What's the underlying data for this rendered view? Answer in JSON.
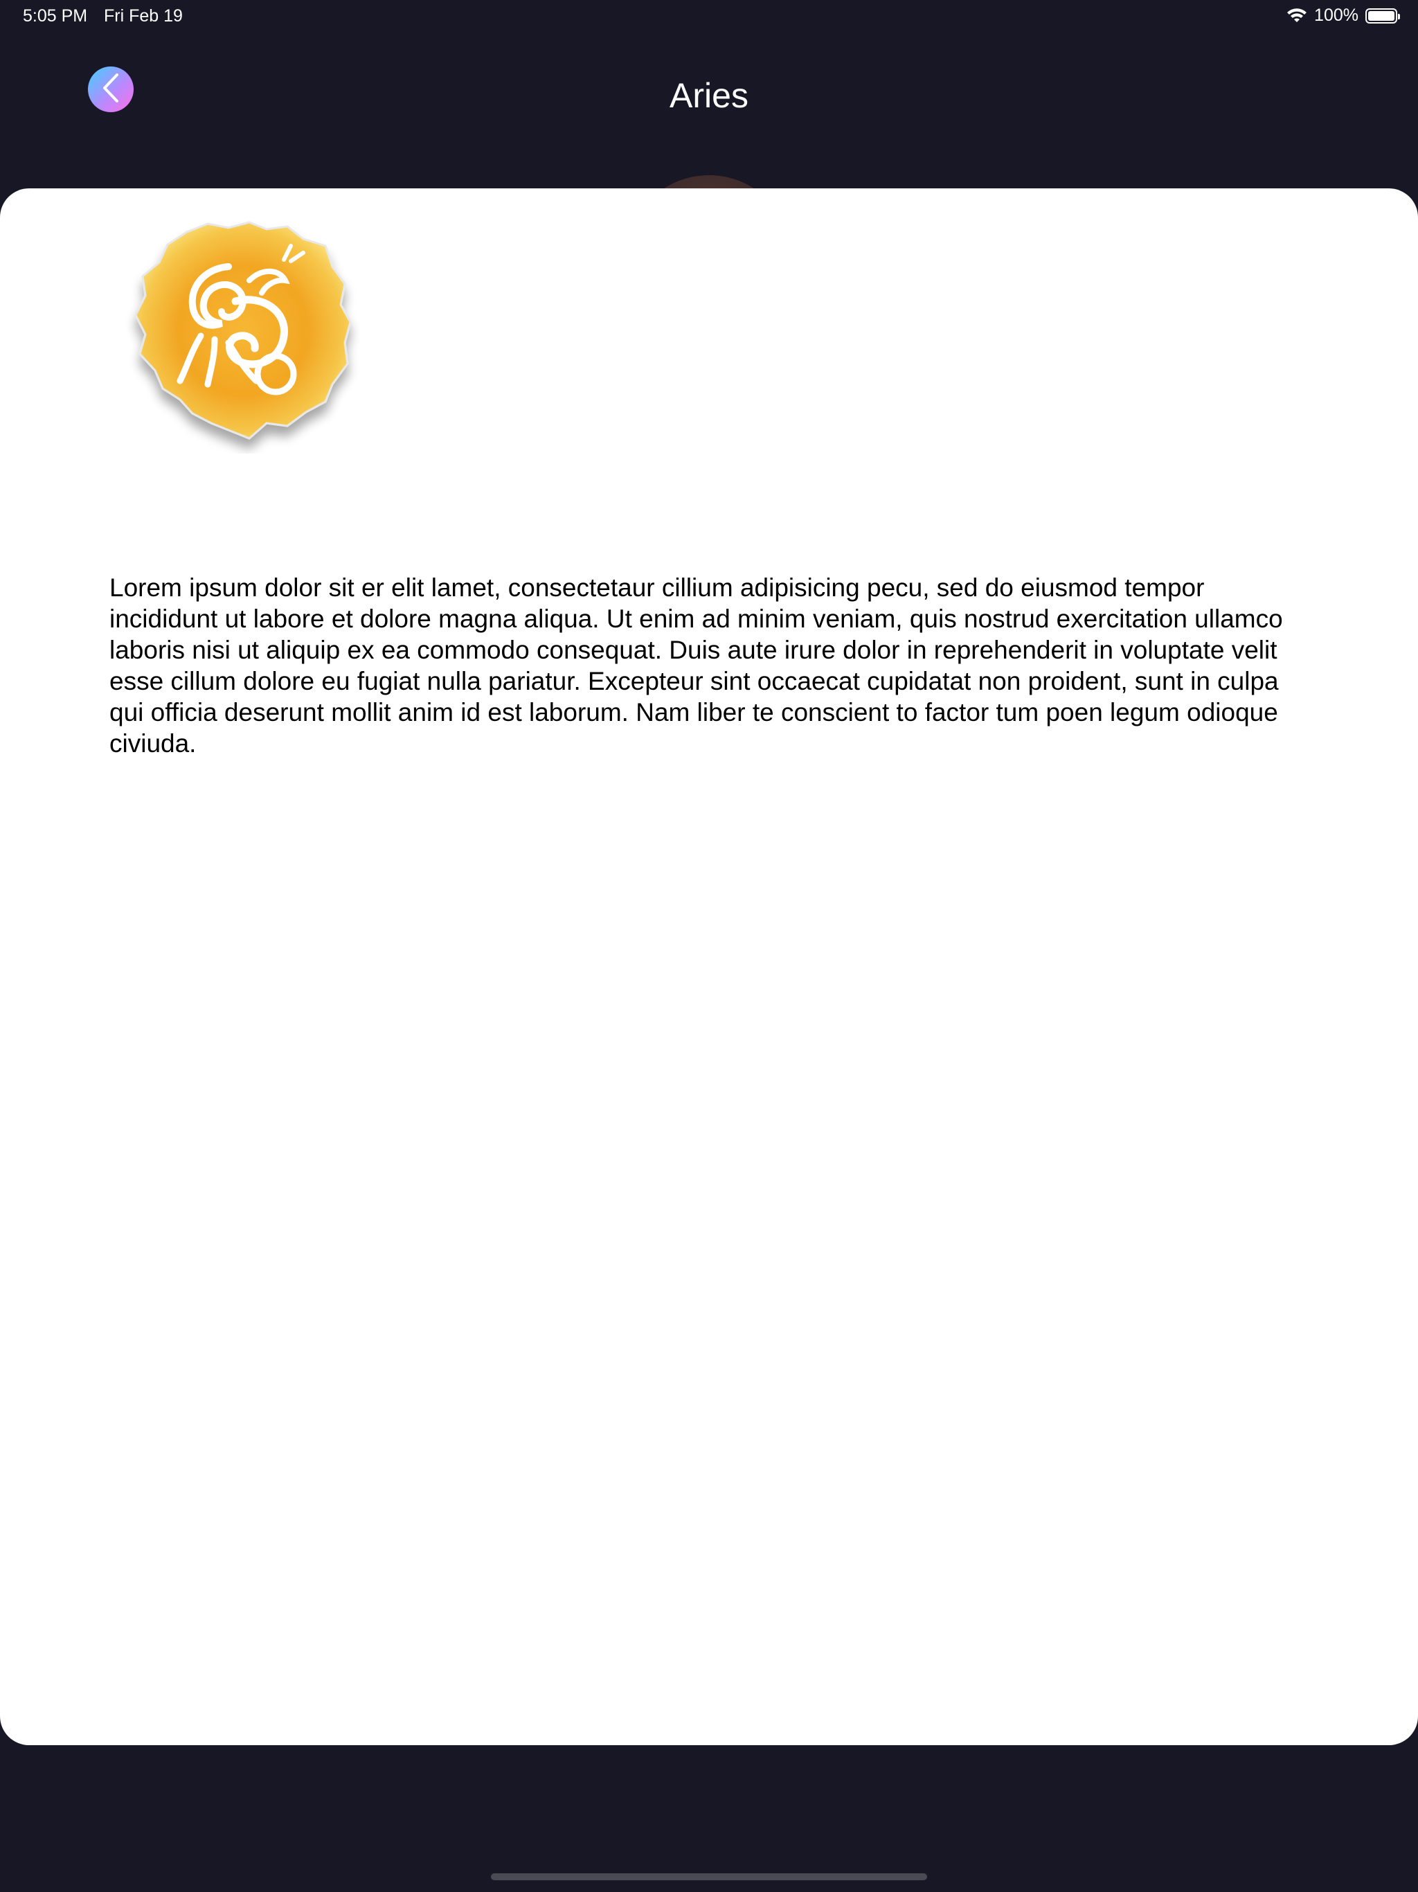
{
  "status_bar": {
    "time": "5:05 PM",
    "date": "Fri Feb 19",
    "battery": "100%",
    "battery_level": 1.0,
    "icons": [
      "wifi-icon",
      "battery-icon"
    ]
  },
  "nav": {
    "back_icon": "chevron-left-icon",
    "title": "Aries"
  },
  "sign": {
    "icon": "aries-ram-icon"
  },
  "content": {
    "description": "Lorem ipsum dolor sit er elit lamet, consectetaur cillium adipisicing pecu, sed do eiusmod tempor incididunt ut labore et dolore magna aliqua. Ut enim ad minim veniam, quis nostrud exercitation ullamco laboris nisi ut aliquip ex ea commodo consequat. Duis aute irure dolor in reprehenderit in voluptate velit esse cillum dolore eu fugiat nulla pariatur. Excepteur sint occaecat cupidatat non proident, sunt in culpa qui officia deserunt mollit anim id est laborum. Nam liber te conscient to factor tum poen legum odioque civiuda."
  },
  "colors": {
    "background": "#181726",
    "card": "#ffffff",
    "sign_orange": "#f2a623",
    "back_gradient_start": "#3fd1ff",
    "back_gradient_end": "#ff6ee6"
  }
}
